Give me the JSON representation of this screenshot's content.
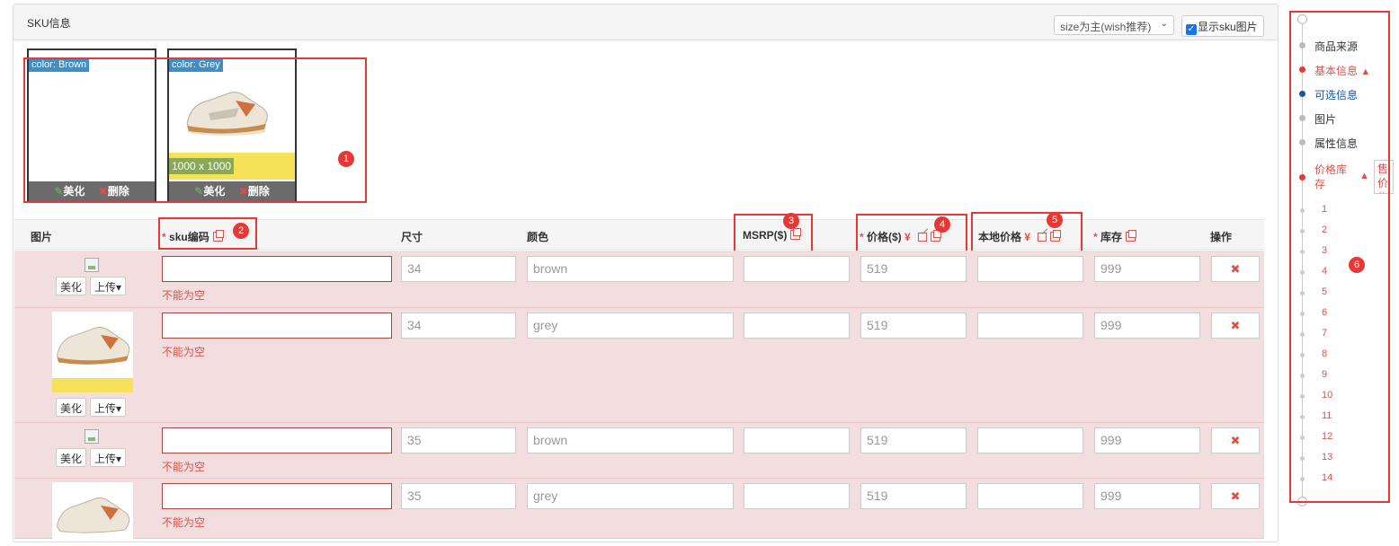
{
  "panel": {
    "title": "SKU信息",
    "size_select": "size为主(wish推荐)",
    "show_sku_images": "显示sku图片"
  },
  "image_cards": [
    {
      "color_label": "color: Brown",
      "beautify": "美化",
      "delete": "删除"
    },
    {
      "color_label": "color: Grey",
      "beautify": "美化",
      "delete": "删除",
      "dimensions": "1000 x 1000"
    }
  ],
  "annotations": [
    "1",
    "2",
    "3",
    "4",
    "5",
    "6"
  ],
  "table": {
    "headers": {
      "image": "图片",
      "sku_code": "sku编码",
      "size": "尺寸",
      "color": "颜色",
      "msrp": "MSRP($)",
      "price": "价格($)",
      "price_currency": "¥",
      "local_price": "本地价格",
      "local_currency": "¥",
      "stock": "库存",
      "actions": "操作"
    },
    "required_mark": "*",
    "rows": [
      {
        "sku": "",
        "size": "34",
        "color": "brown",
        "msrp": "",
        "price": "519",
        "local_price": "",
        "stock": "999",
        "error": "不能为空",
        "has_image": false
      },
      {
        "sku": "",
        "size": "34",
        "color": "grey",
        "msrp": "",
        "price": "519",
        "local_price": "",
        "stock": "999",
        "error": "不能为空",
        "has_image": true
      },
      {
        "sku": "",
        "size": "35",
        "color": "brown",
        "msrp": "",
        "price": "519",
        "local_price": "",
        "stock": "999",
        "error": "不能为空",
        "has_image": false
      },
      {
        "sku": "",
        "size": "35",
        "color": "grey",
        "msrp": "",
        "price": "519",
        "local_price": "",
        "stock": "999",
        "error": "不能为空",
        "has_image": true
      }
    ],
    "beautify_btn": "美化",
    "upload_btn": "上传",
    "delete_glyph": "✖"
  },
  "sidenav": {
    "items": [
      {
        "label": "商品来源",
        "state": "normal"
      },
      {
        "label": "基本信息",
        "state": "error"
      },
      {
        "label": "可选信息",
        "state": "active"
      },
      {
        "label": "图片",
        "state": "normal"
      },
      {
        "label": "属性信息",
        "state": "normal"
      },
      {
        "label": "价格库存",
        "state": "error"
      }
    ],
    "price_stock_extra": "售价修改",
    "sub_items": [
      "1",
      "2",
      "3",
      "4",
      "5",
      "6",
      "7",
      "8",
      "9",
      "10",
      "11",
      "12",
      "13",
      "14"
    ]
  },
  "colors": {
    "accent_red": "#e53935",
    "error_bg": "#f2dede",
    "label_blue": "#3f8ec7",
    "active_nav": "#1a56a0"
  }
}
